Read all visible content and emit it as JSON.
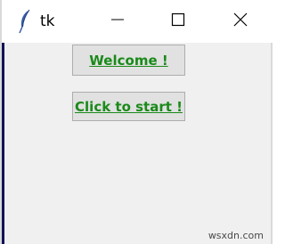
{
  "window": {
    "title": "tk",
    "controls": {
      "minimize_icon": "minimize-icon",
      "maximize_icon": "maximize-icon",
      "close_icon": "close-icon"
    }
  },
  "buttons": {
    "welcome_label": "Welcome !",
    "start_label": "Click to start !"
  },
  "watermark": "wsxdn.com",
  "colors": {
    "button_text": "#1a8a1a",
    "button_bg": "#e1e1e1",
    "window_bg": "#f0f0f0"
  }
}
